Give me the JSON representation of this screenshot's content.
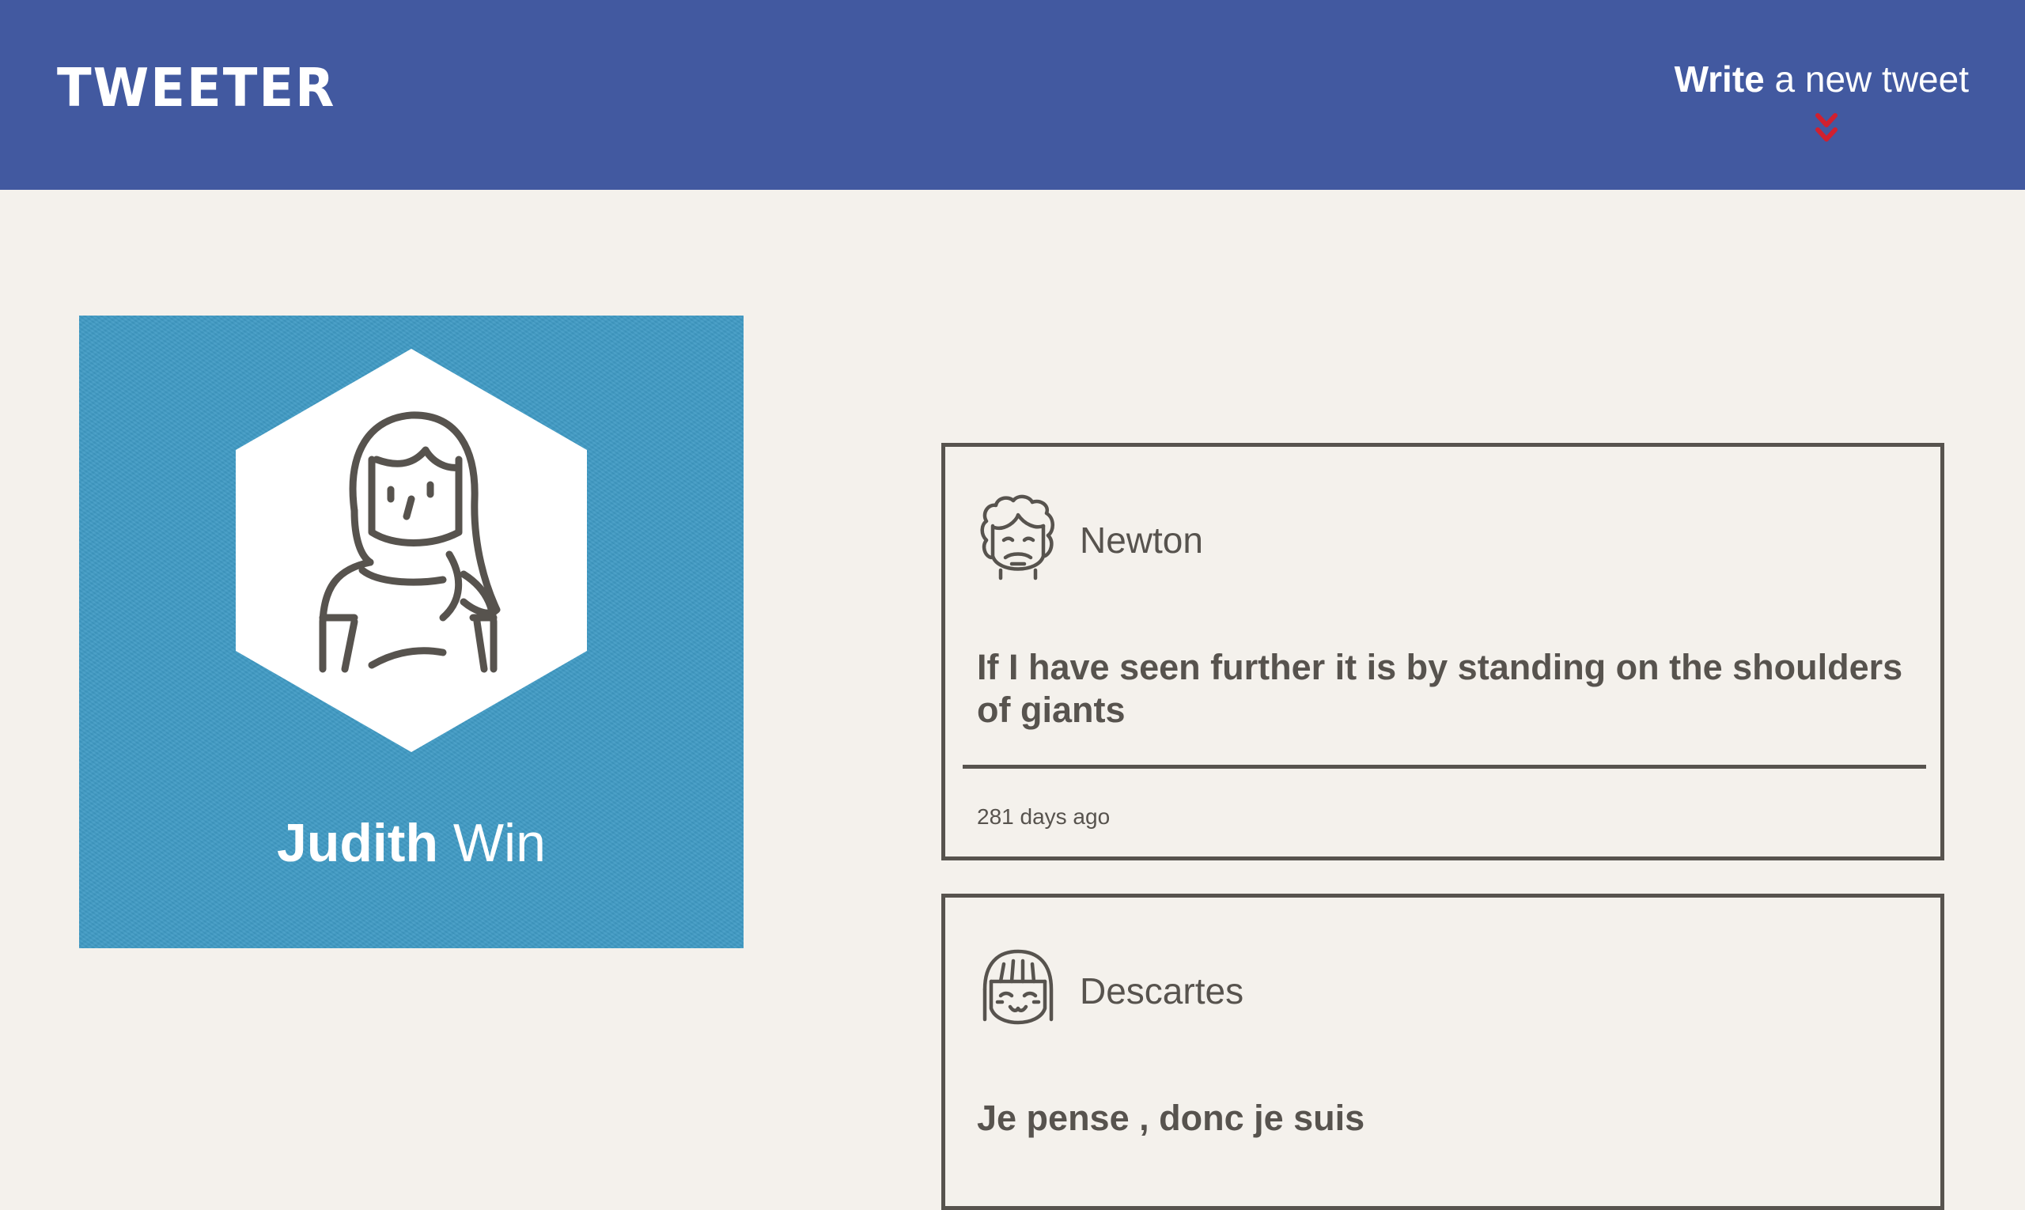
{
  "header": {
    "logo": "TWEETER",
    "write_bold": "Write",
    "write_rest": " a new tweet",
    "background_color": "#4259a0",
    "accent_color": "#d0202f",
    "chevron_icon": "double-chevron-down-icon"
  },
  "profile": {
    "first_name": "Judith",
    "last_name": " Win",
    "avatar_icon": "woman-avatar-icon",
    "card_color": "#3f9ac4"
  },
  "tweets": [
    {
      "author": "Newton",
      "avatar_icon": "newton-avatar-icon",
      "text": "If I have seen further it is by standing on the shoulders of giants",
      "time": "281 days ago"
    },
    {
      "author": "Descartes",
      "avatar_icon": "descartes-avatar-icon",
      "text": "Je pense , donc je suis"
    }
  ]
}
